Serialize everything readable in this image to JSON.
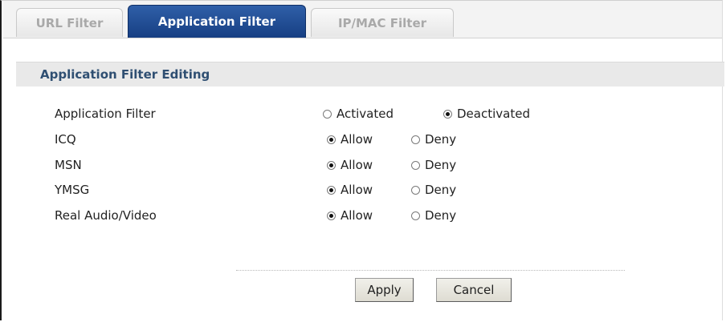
{
  "tabs": [
    {
      "label": "URL Filter",
      "active": false
    },
    {
      "label": "Application Filter",
      "active": true
    },
    {
      "label": "IP/MAC Filter",
      "active": false
    }
  ],
  "section": {
    "title": "Application Filter Editing"
  },
  "rows": [
    {
      "label": "Application Filter",
      "options": [
        {
          "label": "Activated",
          "checked": false
        },
        {
          "label": "Deactivated",
          "checked": true
        }
      ]
    },
    {
      "label": "ICQ",
      "options": [
        {
          "label": "Allow",
          "checked": true
        },
        {
          "label": "Deny",
          "checked": false
        }
      ]
    },
    {
      "label": "MSN",
      "options": [
        {
          "label": "Allow",
          "checked": true
        },
        {
          "label": "Deny",
          "checked": false
        }
      ]
    },
    {
      "label": "YMSG",
      "options": [
        {
          "label": "Allow",
          "checked": true
        },
        {
          "label": "Deny",
          "checked": false
        }
      ]
    },
    {
      "label": "Real Audio/Video",
      "options": [
        {
          "label": "Allow",
          "checked": true
        },
        {
          "label": "Deny",
          "checked": false
        }
      ]
    }
  ],
  "buttons": {
    "apply": "Apply",
    "cancel": "Cancel"
  },
  "colors": {
    "tab_active": "#1f4b91",
    "section_title": "#2f4f72",
    "section_bg": "#e9e9e9"
  }
}
